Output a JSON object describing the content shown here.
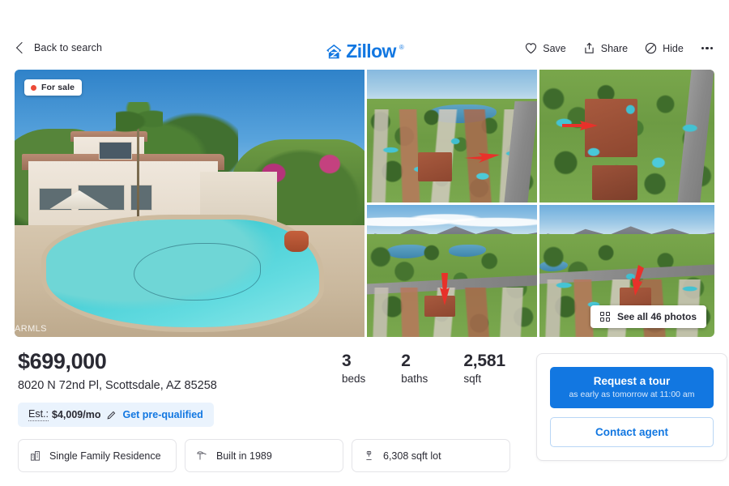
{
  "header": {
    "back_label": "Back to search",
    "back_icon": "chevron-left-icon",
    "logo_text": "Zillow",
    "logo_tm": "®",
    "actions": [
      {
        "label": "Save",
        "icon": "heart-icon"
      },
      {
        "label": "Share",
        "icon": "share-upload-icon"
      },
      {
        "label": "Hide",
        "icon": "hide-slash-circle-icon"
      }
    ],
    "more_icon": "more-horizontal-icon"
  },
  "gallery": {
    "status_badge": {
      "label": "For sale",
      "dot_color": "#ec4a37"
    },
    "watermark": "ARMLS",
    "see_all": {
      "label": "See all 46 photos",
      "icon": "grid-2x2-icon",
      "photo_count": 46
    },
    "photos": [
      {
        "alt": "Backyard swimming pool with two-story stucco home",
        "type": "hero"
      },
      {
        "alt": "Aerial view of neighborhood with highway and lake",
        "type": "aerial"
      },
      {
        "alt": "Overhead satellite view of the property roof",
        "type": "satellite"
      },
      {
        "alt": "Aerial view of golf course and homes with mountains",
        "type": "aerial"
      },
      {
        "alt": "Aerial view of the street and mountain range",
        "type": "aerial"
      }
    ]
  },
  "listing": {
    "price": "$699,000",
    "address": "8020 N 72nd Pl, Scottsdale, AZ 85258",
    "facts": [
      {
        "value": "3",
        "label": "beds"
      },
      {
        "value": "2",
        "label": "baths"
      },
      {
        "value": "2,581",
        "label": "sqft"
      }
    ],
    "estimate": {
      "label": "Est.:",
      "amount": "$4,009/mo",
      "edit_icon": "pencil-icon",
      "link": "Get pre-qualified"
    },
    "features": [
      {
        "icon": "home-type-icon",
        "label": "Single Family Residence"
      },
      {
        "icon": "hammer-icon",
        "label": "Built in 1989"
      },
      {
        "icon": "lot-pin-icon",
        "label": "6,308 sqft lot"
      }
    ]
  },
  "cta": {
    "tour_button": {
      "title": "Request a tour",
      "subtitle": "as early as tomorrow at 11:00 am"
    },
    "contact_button": "Contact agent"
  },
  "colors": {
    "brand_blue": "#1277e1",
    "text": "#2a2a33",
    "status_red": "#ec4a37",
    "chip_blue_bg": "#eaf3fd",
    "border": "#e4e4e8"
  }
}
